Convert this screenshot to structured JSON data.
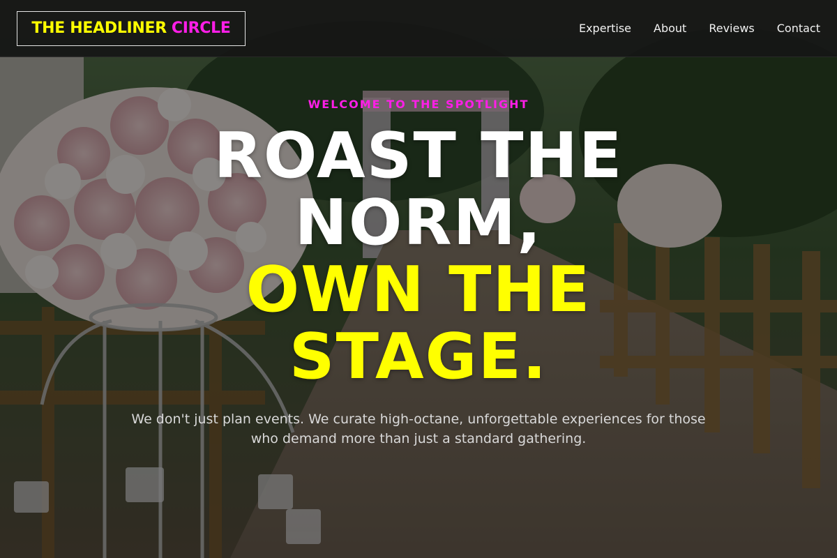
{
  "brand": {
    "name_part1": "THE HEADLINER",
    "name_part2": "CIRCLE"
  },
  "nav": {
    "items": [
      {
        "label": "Expertise"
      },
      {
        "label": "About"
      },
      {
        "label": "Reviews"
      },
      {
        "label": "Contact"
      }
    ]
  },
  "hero": {
    "eyebrow": "WELCOME TO THE SPOTLIGHT",
    "headline_white_1": "ROAST THE",
    "headline_white_2": "NORM,",
    "headline_yellow_1": "OWN THE",
    "headline_yellow_2": "STAGE.",
    "subtext": "We don't just plan events. We curate high-octane, unforgettable experiences for those who demand more than just a standard gathering."
  },
  "colors": {
    "accent_yellow": "#ffff00",
    "accent_magenta": "#ff1ee8",
    "header_bg": "#161616",
    "text_light": "#d9d9d9"
  },
  "background": {
    "scene": "outdoor wedding aisle with floral bouquets and wooden chairs"
  }
}
